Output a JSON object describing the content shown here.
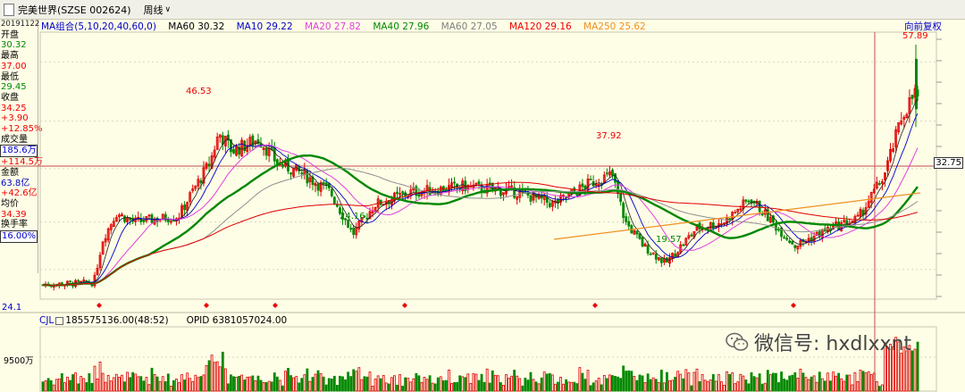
{
  "titlebar": {
    "security": "完美世界(SZSE 002624)",
    "period": "周线"
  },
  "info": {
    "date": "20191122",
    "open_label": "开盘",
    "open": "30.32",
    "high_label": "最高",
    "high": "37.00",
    "low_label": "最低",
    "low": "29.45",
    "close_label": "收盘",
    "close": "34.25",
    "change": "+3.90",
    "change_pct": "+12.85%",
    "volume_label": "成交量",
    "volume": "185.6万",
    "volume_change": "+114.5万",
    "amount_label": "金额",
    "amount": "63.8亿",
    "amount_change": "+42.6亿",
    "avg_label": "均价",
    "avg": "34.39",
    "turnover_label": "换手率",
    "turnover": "16.00%"
  },
  "ma_bar": {
    "group": "MA组合(5,10,20,40,60,0)",
    "items": [
      {
        "label": "MA60 30.32",
        "color": "#000000"
      },
      {
        "label": "MA10 29.22",
        "color": "#0000cc"
      },
      {
        "label": "MA20 27.82",
        "color": "#e040e0"
      },
      {
        "label": "MA40 27.96",
        "color": "#008800"
      },
      {
        "label": "MA60 27.05",
        "color": "#808080"
      },
      {
        "label": "MA120 29.16",
        "color": "#e00000"
      },
      {
        "label": "MA250 25.62",
        "color": "#f09020"
      }
    ]
  },
  "adjust_label": "向前复权",
  "annotations": {
    "peak1": "46.53",
    "trough1": "24.16",
    "peak2": "37.92",
    "trough2": "19.57",
    "peak3": "57.89",
    "current_price": "32.75",
    "bottom_left": "24.1"
  },
  "volume_bar": {
    "label": "CJL",
    "value": "185575136.00(48:52)",
    "opid": "OPID 6381057024.00",
    "axis": "9500万"
  },
  "watermark": "微信号: hxdlxxnt",
  "colors": {
    "up": "#e00000",
    "down": "#008800",
    "background": "#fefde6"
  },
  "chart_data": {
    "type": "candlestick",
    "price_range": [
      19.57,
      57.89
    ],
    "points": [
      {
        "label": "46.53",
        "value": 46.53
      },
      {
        "label": "24.16",
        "value": 24.16
      },
      {
        "label": "37.92",
        "value": 37.92
      },
      {
        "label": "19.57",
        "value": 19.57
      },
      {
        "label": "57.89",
        "value": 57.89
      }
    ]
  }
}
